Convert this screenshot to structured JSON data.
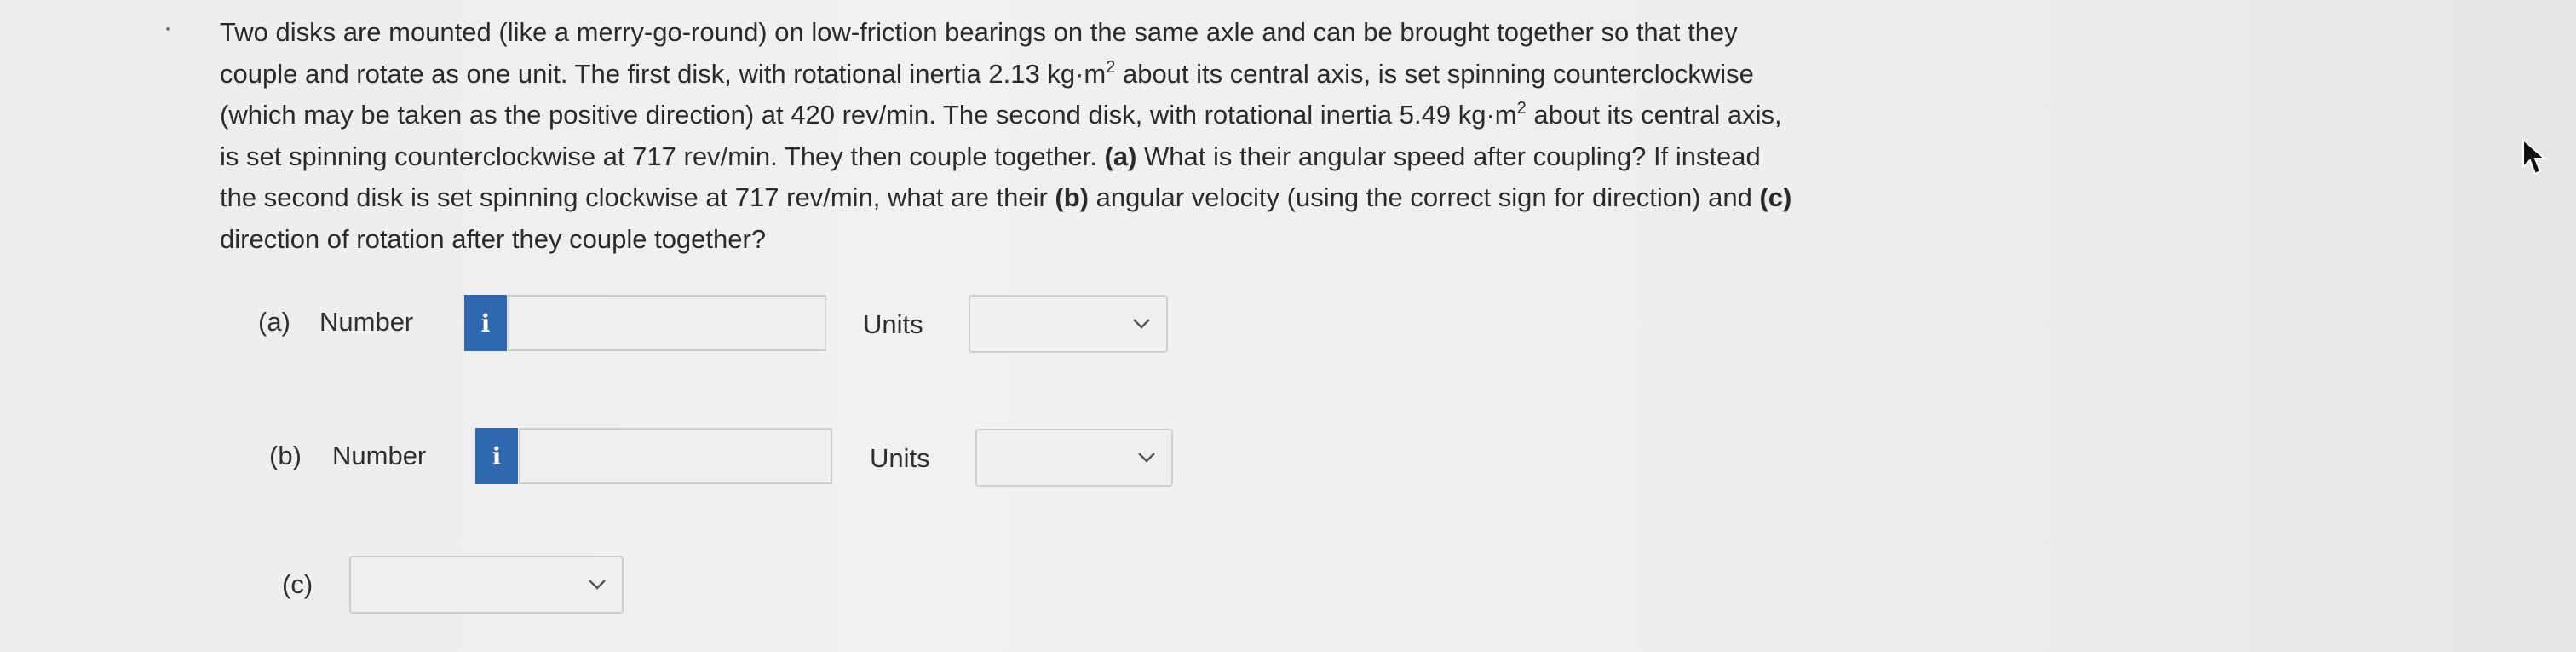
{
  "question": {
    "bullet": "·",
    "lines": [
      {
        "segments": [
          {
            "t": "Two disks are mounted (like a merry-go-round) on low-friction bearings on the same axle and can be brought together so that they"
          }
        ]
      },
      {
        "segments": [
          {
            "t": "couple and rotate as one unit. The first disk, with rotational inertia 2.13 kg·m"
          },
          {
            "t": "2",
            "sup": true
          },
          {
            "t": " about its central axis, is set spinning counterclockwise"
          }
        ]
      },
      {
        "segments": [
          {
            "t": "(which may be taken as the positive direction) at 420 rev/min. The second disk, with rotational inertia 5.49 kg·m"
          },
          {
            "t": "2",
            "sup": true
          },
          {
            "t": " about its central axis,"
          }
        ]
      },
      {
        "segments": [
          {
            "t": "is set spinning counterclockwise at 717 rev/min. They then couple together. "
          },
          {
            "t": "(a)",
            "bold": true
          },
          {
            "t": " What is their angular speed after coupling? If instead"
          }
        ]
      },
      {
        "segments": [
          {
            "t": "the second disk is set spinning clockwise at 717 rev/min, what are their "
          },
          {
            "t": "(b)",
            "bold": true
          },
          {
            "t": " angular velocity (using the correct sign for direction) and "
          },
          {
            "t": "(c)",
            "bold": true
          }
        ]
      },
      {
        "segments": [
          {
            "t": "direction of rotation after they couple together?"
          }
        ]
      }
    ]
  },
  "part_a": {
    "label": "(a)",
    "number_label": "Number",
    "info_icon": "i",
    "number_value": "",
    "units_label": "Units",
    "units_selected": ""
  },
  "part_b": {
    "label": "(b)",
    "number_label": "Number",
    "info_icon": "i",
    "number_value": "",
    "units_label": "Units",
    "units_selected": ""
  },
  "part_c": {
    "label": "(c)",
    "direction_selected": ""
  },
  "colors": {
    "info_button": "#2f67b0",
    "background": "#ececec",
    "text": "#2a2a2a"
  }
}
